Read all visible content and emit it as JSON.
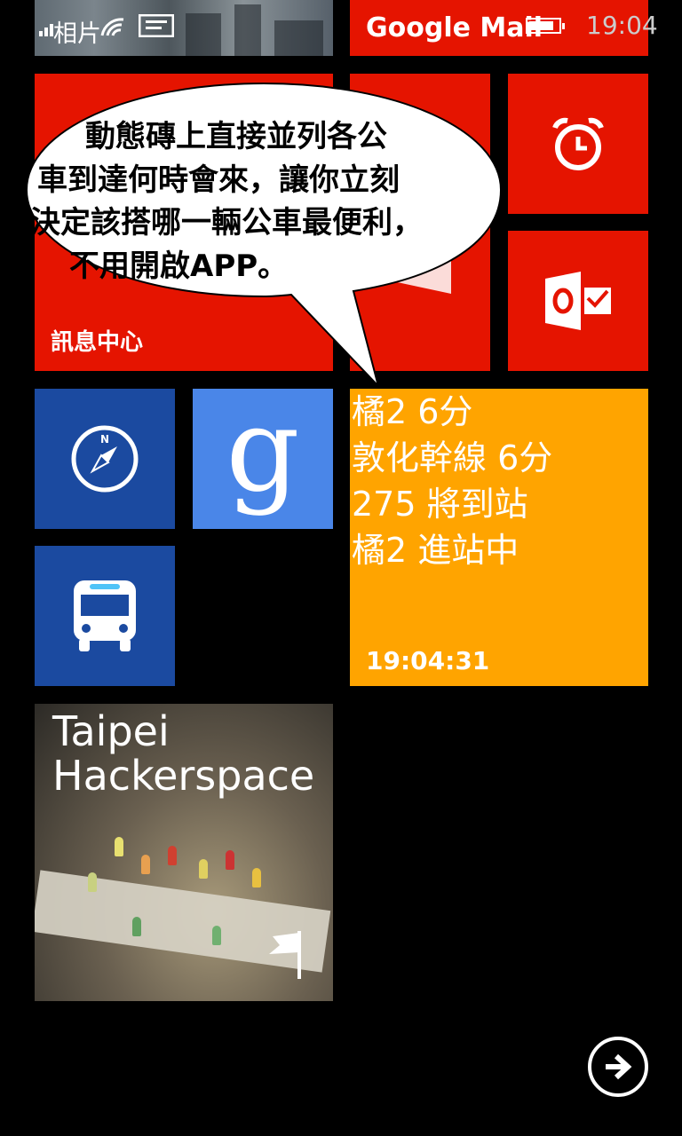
{
  "status_bar": {
    "photos_label": "相片",
    "app_title": "Google Mail",
    "time": "19:04",
    "battery_level": 0.85
  },
  "tiles": {
    "messaging_label": "訊息中心",
    "compass_icon": "compass-icon",
    "google_icon": "google-g-icon",
    "bus_icon": "bus-icon",
    "alarm_icon": "alarm-clock-icon",
    "outlook_icon": "outlook-icon",
    "office_icon": "office-icon"
  },
  "bus_tile": {
    "lines": [
      "橘2 6分",
      "敦化幹線 6分",
      "275 將到站",
      "橘2 進站中"
    ],
    "updated": "19:04:31"
  },
  "hackerspace_tile": {
    "title": "Taipei Hackerspace"
  },
  "callout": {
    "lines": [
      "動態磚上直接並列各公",
      "車到達何時會來，讓你立刻",
      "決定該搭哪一輛公車最便利，",
      "不用開啟APP。"
    ]
  },
  "colors": {
    "red_tile": "#e51400",
    "blue_tile": "#1b4aa0",
    "google_tile": "#4a86e8",
    "bus_tile": "#ffa400"
  }
}
